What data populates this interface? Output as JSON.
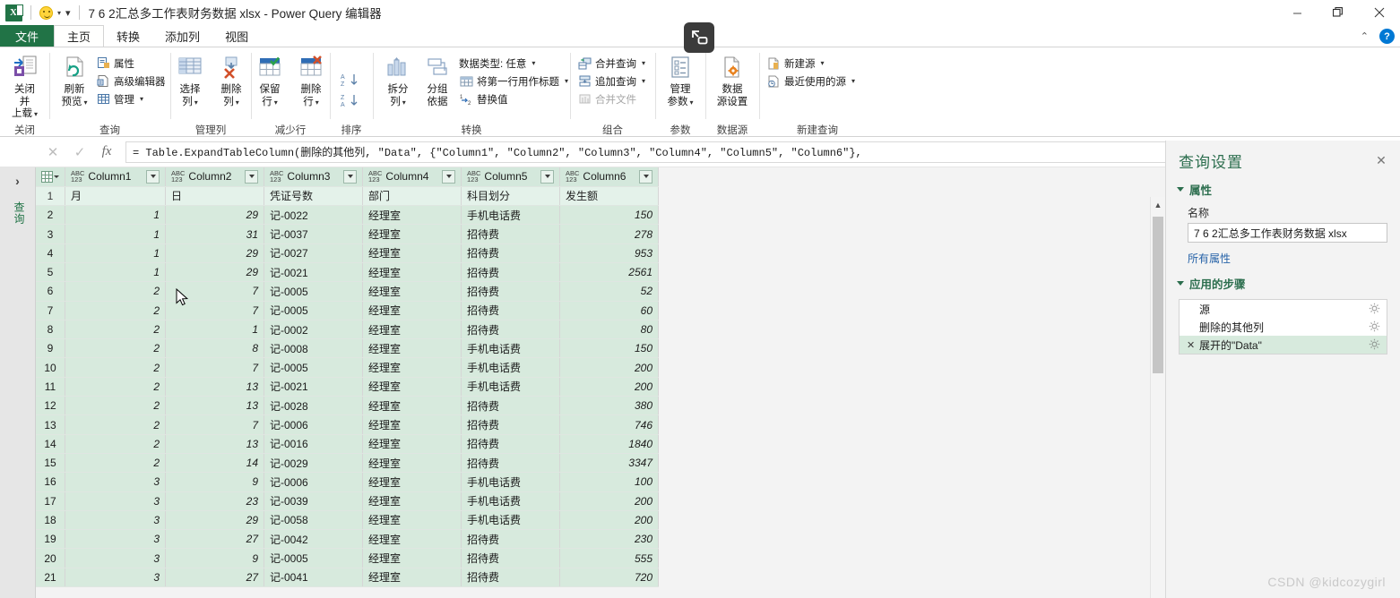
{
  "titlebar": {
    "app_badge": "X",
    "document_title": "7 6 2汇总多工作表财务数据 xlsx - Power Query 编辑器",
    "quick_access_smiley": "smiley-icon",
    "quick_access_more": "▾",
    "minimize": "–",
    "restore": "❐",
    "close": "✕"
  },
  "tabs": [
    {
      "label": "文件",
      "type": "file"
    },
    {
      "label": "主页",
      "type": "active"
    },
    {
      "label": "转换",
      "type": "normal"
    },
    {
      "label": "添加列",
      "type": "normal"
    },
    {
      "label": "视图",
      "type": "normal"
    }
  ],
  "tabstrip_right": {
    "collapse_ribbon": "⌃",
    "help": "?"
  },
  "ribbon": {
    "groups": [
      {
        "label": "关闭",
        "big_buttons": [
          {
            "name": "close-and-load-button",
            "line1": "关闭并",
            "line2": "上载",
            "dropdown": true,
            "icon": "save-upload-icon"
          }
        ],
        "small_buttons": []
      },
      {
        "label": "查询",
        "big_buttons": [
          {
            "name": "refresh-preview-button",
            "line1": "刷新",
            "line2": "预览",
            "dropdown": true,
            "icon": "refresh-icon"
          }
        ],
        "small_buttons": [
          {
            "name": "properties-button",
            "label": "属性",
            "icon": "properties-icon",
            "dropdown": false,
            "disabled": false
          },
          {
            "name": "advanced-editor-button",
            "label": "高级编辑器",
            "icon": "advanced-editor-icon",
            "dropdown": false,
            "disabled": false
          },
          {
            "name": "manage-button",
            "label": "管理",
            "icon": "manage-grid-icon",
            "dropdown": true,
            "disabled": false
          }
        ]
      },
      {
        "label": "管理列",
        "big_buttons": [
          {
            "name": "choose-columns-button",
            "line1": "选择",
            "line2": "列",
            "dropdown": true,
            "icon": "choose-columns-icon"
          },
          {
            "name": "remove-columns-button",
            "line1": "删除",
            "line2": "列",
            "dropdown": true,
            "icon": "remove-columns-icon"
          }
        ],
        "small_buttons": []
      },
      {
        "label": "减少行",
        "big_buttons": [
          {
            "name": "keep-rows-button",
            "line1": "保留",
            "line2": "行",
            "dropdown": true,
            "icon": "keep-rows-icon"
          },
          {
            "name": "remove-rows-button",
            "line1": "删除",
            "line2": "行",
            "dropdown": true,
            "icon": "remove-rows-icon"
          }
        ],
        "small_buttons": []
      },
      {
        "label": "排序",
        "big_buttons": [],
        "small_buttons": [
          {
            "name": "sort-ascending-button",
            "label": "",
            "icon": "sort-az-icon",
            "dropdown": false,
            "disabled": false
          },
          {
            "name": "sort-descending-button",
            "label": "",
            "icon": "sort-za-icon",
            "dropdown": false,
            "disabled": false
          }
        ]
      },
      {
        "label": "转换",
        "big_buttons": [
          {
            "name": "split-column-button",
            "line1": "拆分",
            "line2": "列",
            "dropdown": true,
            "icon": "split-column-icon"
          },
          {
            "name": "group-by-button",
            "line1": "分组",
            "line2": "依据",
            "dropdown": false,
            "icon": "group-by-icon"
          }
        ],
        "small_buttons": [
          {
            "name": "data-type-button",
            "label": "数据类型: 任意",
            "icon": "",
            "dropdown": true,
            "disabled": false
          },
          {
            "name": "use-first-row-as-headers-button",
            "label": "将第一行用作标题",
            "icon": "header-row-icon",
            "dropdown": true,
            "disabled": false
          },
          {
            "name": "replace-values-button",
            "label": "替换值",
            "icon": "replace-values-icon",
            "dropdown": false,
            "disabled": false
          }
        ]
      },
      {
        "label": "组合",
        "big_buttons": [],
        "small_buttons": [
          {
            "name": "merge-queries-button",
            "label": "合并查询",
            "icon": "merge-queries-icon",
            "dropdown": true,
            "disabled": false
          },
          {
            "name": "append-queries-button",
            "label": "追加查询",
            "icon": "append-queries-icon",
            "dropdown": true,
            "disabled": false
          },
          {
            "name": "combine-files-button",
            "label": "合并文件",
            "icon": "combine-files-icon",
            "dropdown": false,
            "disabled": true
          }
        ]
      },
      {
        "label": "参数",
        "big_buttons": [
          {
            "name": "manage-parameters-button",
            "line1": "管理",
            "line2": "参数",
            "dropdown": true,
            "icon": "parameters-icon"
          }
        ],
        "small_buttons": []
      },
      {
        "label": "数据源",
        "big_buttons": [
          {
            "name": "data-source-settings-button",
            "line1": "数据",
            "line2": "源设置",
            "dropdown": false,
            "icon": "data-source-icon"
          }
        ],
        "small_buttons": []
      },
      {
        "label": "新建查询",
        "big_buttons": [],
        "small_buttons": [
          {
            "name": "new-source-button",
            "label": "新建源",
            "icon": "new-source-icon",
            "dropdown": true,
            "disabled": false
          },
          {
            "name": "recent-sources-button",
            "label": "最近使用的源",
            "icon": "recent-sources-icon",
            "dropdown": true,
            "disabled": false
          }
        ]
      }
    ]
  },
  "formula_bar": {
    "cancel": "✕",
    "accept": "✓",
    "fx": "fx",
    "value": "= Table.ExpandTableColumn(删除的其他列, \"Data\", {\"Column1\", \"Column2\", \"Column3\", \"Column4\", \"Column5\", \"Column6\"},",
    "expand": "⌄"
  },
  "left_rail": {
    "expand_chevron": "›",
    "vertical_label": "查询"
  },
  "grid": {
    "columns": [
      {
        "type_badge_top": "ABC",
        "type_badge_bottom": "123",
        "name": "Column1"
      },
      {
        "type_badge_top": "ABC",
        "type_badge_bottom": "123",
        "name": "Column2"
      },
      {
        "type_badge_top": "ABC",
        "type_badge_bottom": "123",
        "name": "Column3"
      },
      {
        "type_badge_top": "ABC",
        "type_badge_bottom": "123",
        "name": "Column4"
      },
      {
        "type_badge_top": "ABC",
        "type_badge_bottom": "123",
        "name": "Column5"
      },
      {
        "type_badge_top": "ABC",
        "type_badge_bottom": "123",
        "name": "Column6"
      }
    ],
    "rows": [
      {
        "n": "1",
        "header": true,
        "cells": [
          "月",
          "日",
          "凭证号数",
          "部门",
          "科目划分",
          "发生额"
        ]
      },
      {
        "n": "2",
        "header": false,
        "cells": [
          "1",
          "29",
          "记-0022",
          "经理室",
          "手机电话费",
          "150"
        ]
      },
      {
        "n": "3",
        "header": false,
        "cells": [
          "1",
          "31",
          "记-0037",
          "经理室",
          "招待费",
          "278"
        ]
      },
      {
        "n": "4",
        "header": false,
        "cells": [
          "1",
          "29",
          "记-0027",
          "经理室",
          "招待费",
          "953"
        ]
      },
      {
        "n": "5",
        "header": false,
        "cells": [
          "1",
          "29",
          "记-0021",
          "经理室",
          "招待费",
          "2561"
        ]
      },
      {
        "n": "6",
        "header": false,
        "cells": [
          "2",
          "7",
          "记-0005",
          "经理室",
          "招待费",
          "52"
        ]
      },
      {
        "n": "7",
        "header": false,
        "cells": [
          "2",
          "7",
          "记-0005",
          "经理室",
          "招待费",
          "60"
        ]
      },
      {
        "n": "8",
        "header": false,
        "cells": [
          "2",
          "1",
          "记-0002",
          "经理室",
          "招待费",
          "80"
        ]
      },
      {
        "n": "9",
        "header": false,
        "cells": [
          "2",
          "8",
          "记-0008",
          "经理室",
          "手机电话费",
          "150"
        ]
      },
      {
        "n": "10",
        "header": false,
        "cells": [
          "2",
          "7",
          "记-0005",
          "经理室",
          "手机电话费",
          "200"
        ]
      },
      {
        "n": "11",
        "header": false,
        "cells": [
          "2",
          "13",
          "记-0021",
          "经理室",
          "手机电话费",
          "200"
        ]
      },
      {
        "n": "12",
        "header": false,
        "cells": [
          "2",
          "13",
          "记-0028",
          "经理室",
          "招待费",
          "380"
        ]
      },
      {
        "n": "13",
        "header": false,
        "cells": [
          "2",
          "7",
          "记-0006",
          "经理室",
          "招待费",
          "746"
        ]
      },
      {
        "n": "14",
        "header": false,
        "cells": [
          "2",
          "13",
          "记-0016",
          "经理室",
          "招待费",
          "1840"
        ]
      },
      {
        "n": "15",
        "header": false,
        "cells": [
          "2",
          "14",
          "记-0029",
          "经理室",
          "招待费",
          "3347"
        ]
      },
      {
        "n": "16",
        "header": false,
        "cells": [
          "3",
          "9",
          "记-0006",
          "经理室",
          "手机电话费",
          "100"
        ]
      },
      {
        "n": "17",
        "header": false,
        "cells": [
          "3",
          "23",
          "记-0039",
          "经理室",
          "手机电话费",
          "200"
        ]
      },
      {
        "n": "18",
        "header": false,
        "cells": [
          "3",
          "29",
          "记-0058",
          "经理室",
          "手机电话费",
          "200"
        ]
      },
      {
        "n": "19",
        "header": false,
        "cells": [
          "3",
          "27",
          "记-0042",
          "经理室",
          "招待费",
          "230"
        ]
      },
      {
        "n": "20",
        "header": false,
        "cells": [
          "3",
          "9",
          "记-0005",
          "经理室",
          "招待费",
          "555"
        ]
      },
      {
        "n": "21",
        "header": false,
        "cells": [
          "3",
          "27",
          "记-0041",
          "经理室",
          "招待费",
          "720"
        ]
      }
    ]
  },
  "query_settings": {
    "title": "查询设置",
    "close": "✕",
    "properties_section": "属性",
    "name_label": "名称",
    "name_value": "7 6 2汇总多工作表财务数据 xlsx",
    "all_properties_link": "所有属性",
    "steps_section": "应用的步骤",
    "steps": [
      {
        "label": "源",
        "selected": false,
        "has_delete": false,
        "has_gear": true
      },
      {
        "label": "删除的其他列",
        "selected": false,
        "has_delete": false,
        "has_gear": true
      },
      {
        "label": "展开的\"Data\"",
        "selected": true,
        "has_delete": true,
        "has_gear": true
      }
    ]
  },
  "watermark": "CSDN @kidcozygirl"
}
